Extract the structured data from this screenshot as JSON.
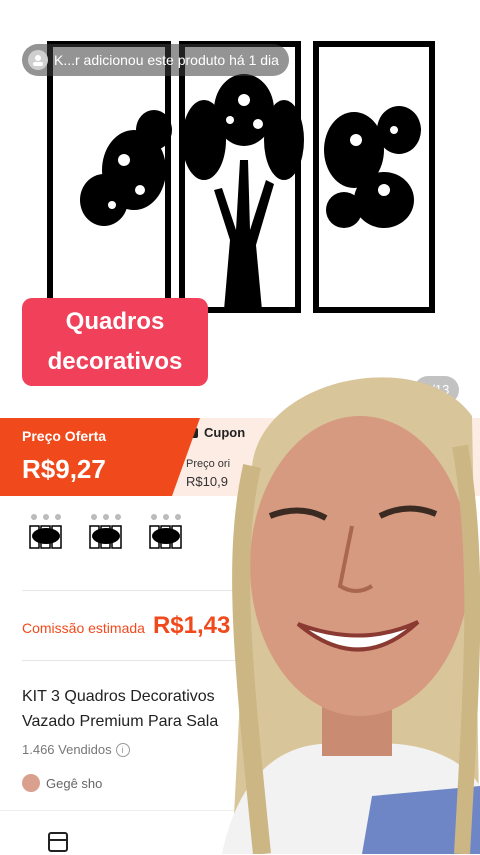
{
  "notification": {
    "text": "K...r adicionou este produto há 1 dia"
  },
  "caption": {
    "line1": "Quadros",
    "line2": "decorativos"
  },
  "slide_counter": "2/13",
  "offer": {
    "label": "Preço Oferta",
    "price": "R$9,27"
  },
  "coupon": {
    "label": "Cupon",
    "original_label": "Preço ori",
    "original_price": "R$10,9"
  },
  "commission": {
    "label": "Comissão estimada",
    "value": "R$1,43"
  },
  "product": {
    "title_line1": "KIT 3 Quadros Decorativos",
    "title_line2": "Vazado Premium Para Sala",
    "sold": "1.466 Vendidos"
  },
  "shop": {
    "name": "Gegê sho"
  },
  "colors": {
    "accent": "#f04a1c",
    "caption_bg": "#f0405a",
    "coupon_bg": "#fdece4"
  },
  "icons": [
    "avatar-icon",
    "coupon-icon",
    "info-icon",
    "storefront-icon"
  ]
}
